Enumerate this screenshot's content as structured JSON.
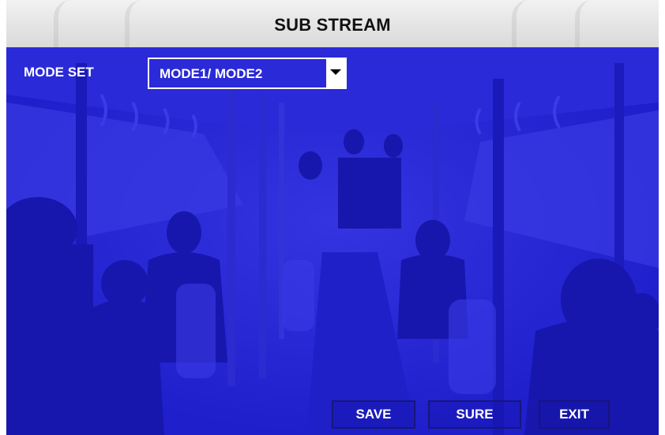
{
  "title": "SUB STREAM",
  "mode_set": {
    "label": "MODE SET",
    "value": "MODE1/ MODE2",
    "dropdown_icon": "chevron-down-icon"
  },
  "buttons": {
    "save": "SAVE",
    "sure": "SURE",
    "exit": "EXIT"
  },
  "colors": {
    "overlay_blue": "#2323d6",
    "title_bar": "#e4e4e4",
    "text_light": "#ffffff",
    "title_text": "#111111"
  }
}
